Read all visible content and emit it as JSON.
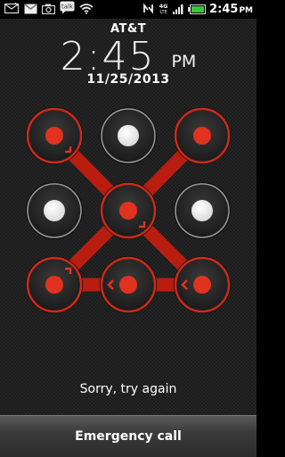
{
  "status_bar": {
    "left_icons": [
      "sms-icon",
      "gmail-icon",
      "camera-icon",
      "talk-icon",
      "wifi-icon"
    ],
    "talk_label": "talk",
    "right_icons": [
      "nfc-icon",
      "4g-lte-icon",
      "signal-icon",
      "battery-icon"
    ],
    "lte_label": "4G LTE",
    "time": "2:45",
    "ampm": "PM"
  },
  "lockscreen": {
    "carrier": "AT&T",
    "time": "2:45",
    "ampm": "PM",
    "date": "11/25/2013"
  },
  "pattern": {
    "state": "error",
    "colors": {
      "error": "#e0321f",
      "line": "#b81d10",
      "ring_error": "#cc2a1c",
      "idle_ring": "#9a9a9a"
    },
    "nodes": [
      {
        "id": 1,
        "active": true,
        "arrow": "down-right"
      },
      {
        "id": 2,
        "active": false
      },
      {
        "id": 3,
        "active": true
      },
      {
        "id": 4,
        "active": false
      },
      {
        "id": 5,
        "active": true,
        "arrow": "down-right"
      },
      {
        "id": 6,
        "active": false
      },
      {
        "id": 7,
        "active": true,
        "arrow": "up-right"
      },
      {
        "id": 8,
        "active": true,
        "arrow": "left"
      },
      {
        "id": 9,
        "active": true,
        "arrow": "left"
      }
    ],
    "sequence": [
      1,
      5,
      7,
      8,
      9,
      5,
      3
    ]
  },
  "message": "Sorry, try again",
  "emergency_label": "Emergency call"
}
